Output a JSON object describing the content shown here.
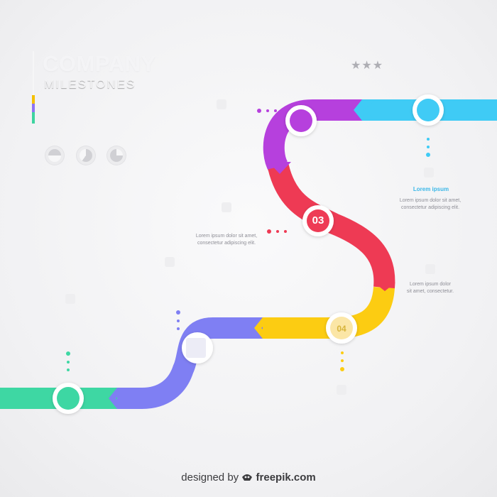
{
  "header": {
    "title": "COMPANY",
    "subtitle": "MILESTONES",
    "stars": "★★★",
    "color_bars": [
      "#f5c000",
      "#8f73f3",
      "#3fd4a0"
    ]
  },
  "colors": {
    "cyan": "#3fcbf5",
    "purple": "#b640dd",
    "red": "#ee3a54",
    "yellow": "#fccc12",
    "periwinkle": "#7f7ff3",
    "mint": "#3ed7a3"
  },
  "pie_icons": [
    "pie-chart-icon",
    "pie-chart-icon",
    "pie-chart-icon"
  ],
  "milestones": [
    {
      "id": "03",
      "number": "03"
    },
    {
      "id": "04",
      "number": "04"
    }
  ],
  "texts": {
    "cyan_heading": "Lorem ipsum",
    "cyan_body": "Lorem ipsum dolor sit amet,\nconsectetur adipiscing elit.",
    "red_body": "Lorem ipsum dolor sit amet,\nconsectetur adipiscing elit.",
    "yellow_body": "Lorem ipsum dolor\nsit amet, consectetur."
  },
  "footer": {
    "prefix": "designed by",
    "brand": "freepik.com",
    "logo_icon": "freepik-logo-icon"
  }
}
